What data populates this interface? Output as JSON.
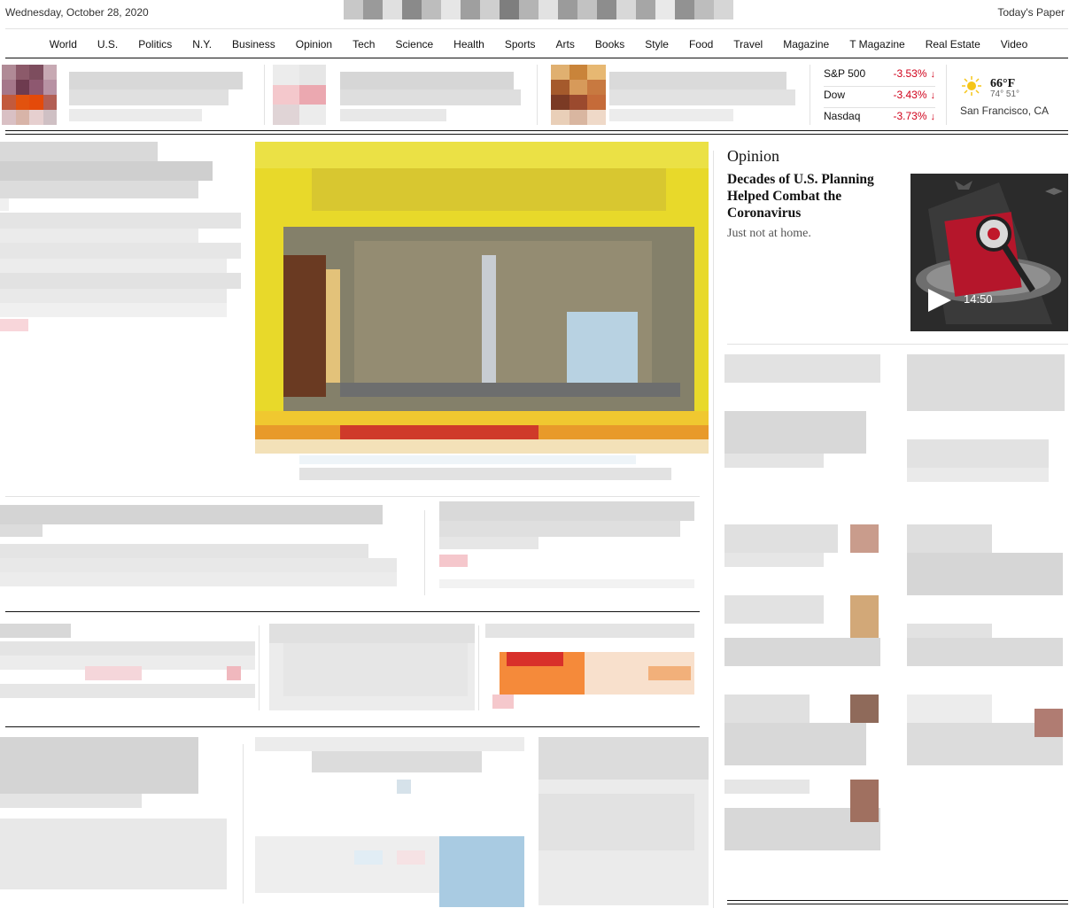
{
  "masthead": {
    "date": "Wednesday, October 28, 2020",
    "todays_paper": "Today's Paper"
  },
  "nav": {
    "items": [
      "World",
      "U.S.",
      "Politics",
      "N.Y.",
      "Business",
      "Opinion",
      "Tech",
      "Science",
      "Health",
      "Sports",
      "Arts",
      "Books",
      "Style",
      "Food",
      "Travel",
      "Magazine",
      "T Magazine",
      "Real Estate",
      "Video"
    ]
  },
  "markets": [
    {
      "name": "S&P 500",
      "change": "-3.53%"
    },
    {
      "name": "Dow",
      "change": "-3.43%"
    },
    {
      "name": "Nasdaq",
      "change": "-3.73%"
    }
  ],
  "weather": {
    "temp": "66°F",
    "hi_lo": "74° 51°",
    "city": "San Francisco, CA",
    "icon": "sun-icon"
  },
  "opinion": {
    "label": "Opinion",
    "headline": "Decades of U.S. Planning Helped Combat the Coronavirus",
    "summary": "Just not at home.",
    "video_duration": "14:50",
    "play_icon": "play-icon"
  },
  "colors": {
    "down": "#d0021b",
    "rule": "#e2e2e2",
    "ink": "#121212"
  }
}
